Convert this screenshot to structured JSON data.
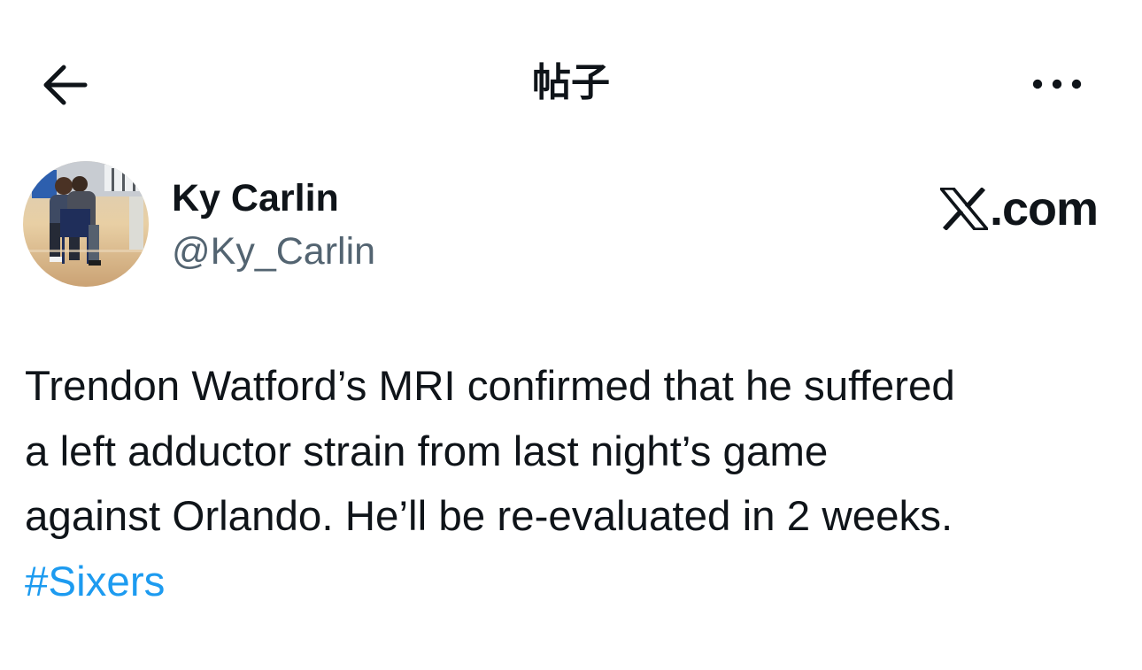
{
  "header": {
    "title": "帖子",
    "back_icon": "arrow-left-icon",
    "more_icon": "more-horizontal-icon"
  },
  "author": {
    "display_name": "Ky Carlin",
    "handle": "@Ky_Carlin",
    "avatar_icon": "avatar-photo"
  },
  "watermark": {
    "logo_icon": "x-logo-icon",
    "text": ".com"
  },
  "tweet": {
    "lines": [
      "Trendon Watford’s MRI confirmed that he suffered",
      "a left adductor strain from last night’s game",
      "against Orlando. He’ll be re-evaluated in 2 weeks."
    ],
    "hashtag": "#Sixers"
  },
  "colors": {
    "text": "#0f1419",
    "secondary_text": "#536471",
    "link": "#1d9bf0",
    "background": "#ffffff"
  }
}
